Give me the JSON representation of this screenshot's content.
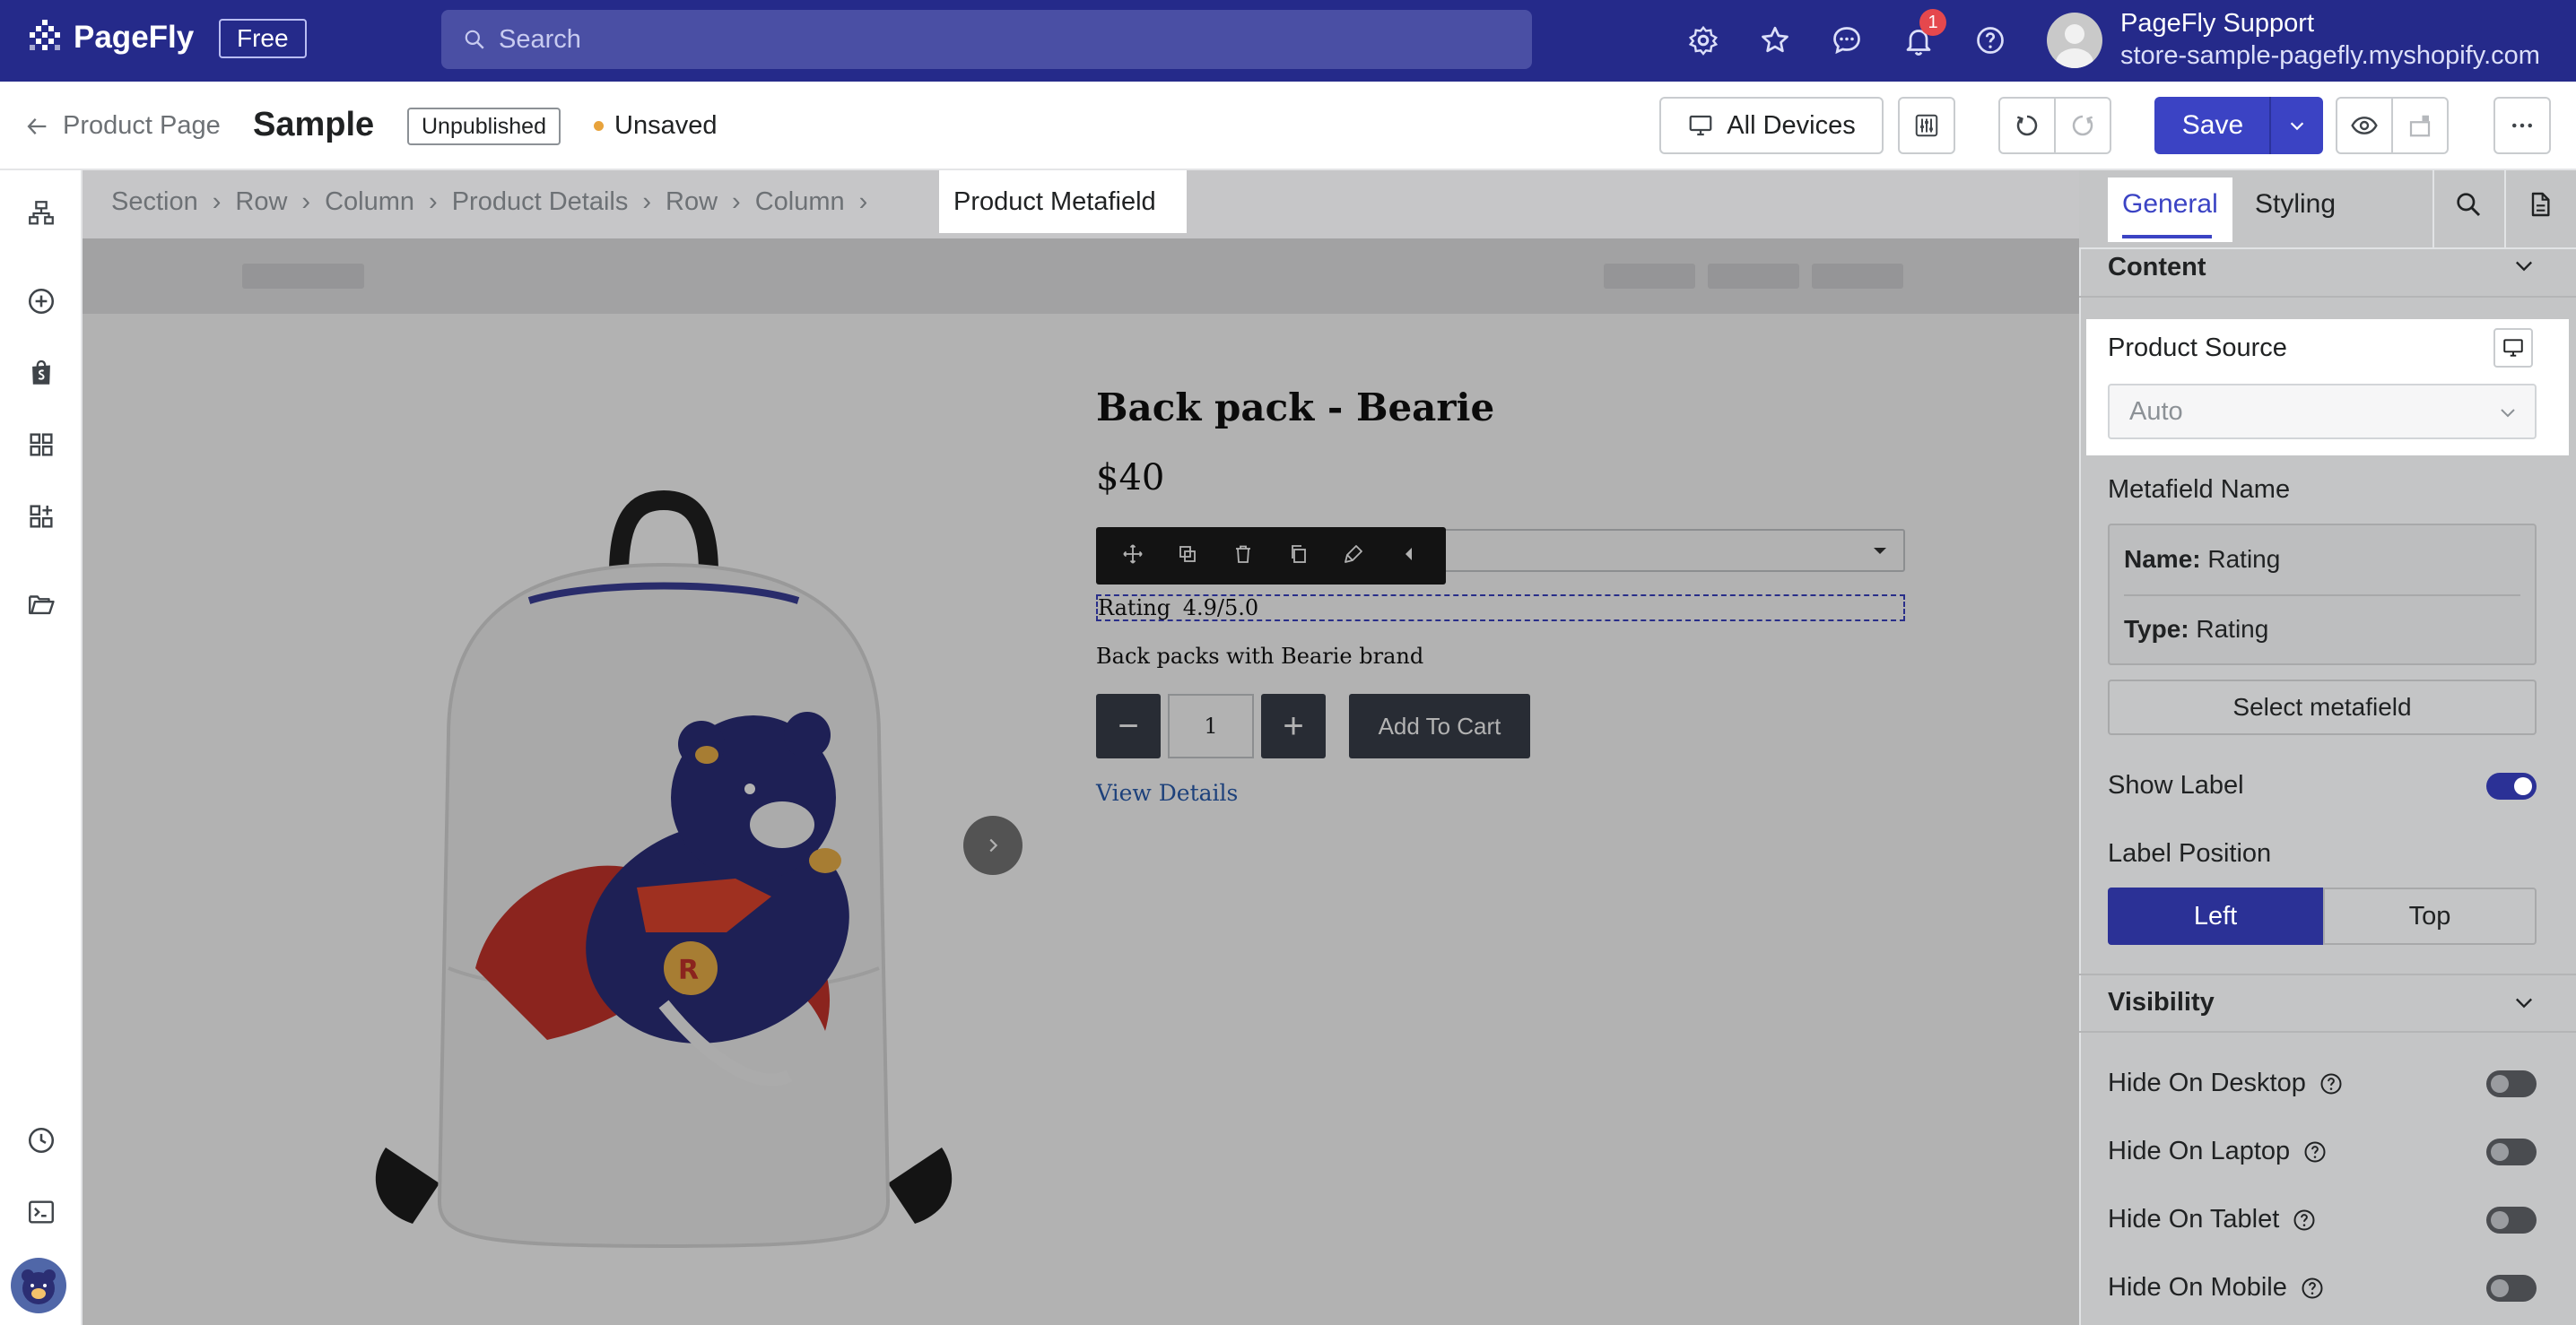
{
  "app": {
    "brand": "PageFly",
    "plan_badge": "Free"
  },
  "search": {
    "placeholder": "Search"
  },
  "notifications": {
    "count": "1"
  },
  "user": {
    "name": "PageFly Support",
    "store": "store-sample-pagefly.myshopify.com"
  },
  "toolbar": {
    "back_label": "Product Page",
    "page_name": "Sample",
    "publish_status": "Unpublished",
    "save_status": "Unsaved",
    "device_label": "All Devices",
    "save_label": "Save"
  },
  "breadcrumb": {
    "items": [
      "Section",
      "Row",
      "Column",
      "Product Details",
      "Row",
      "Column"
    ],
    "active": "Product Metafield"
  },
  "product": {
    "title": "Back pack - Bearie",
    "price": "$40",
    "rating_label": "Rating",
    "rating_value": "4.9/5.0",
    "description": "Back packs with Bearie brand",
    "quantity": "1",
    "add_to_cart": "Add To Cart",
    "view_details": "View Details"
  },
  "panel": {
    "tabs": [
      "General",
      "Styling"
    ],
    "content_heading": "Content",
    "product_source_label": "Product Source",
    "product_source_value": "Auto",
    "metafield_name_label": "Metafield Name",
    "metafield_name_key": "Name:",
    "metafield_name_value": "Rating",
    "metafield_type_key": "Type:",
    "metafield_type_value": "Rating",
    "select_metafield": "Select metafield",
    "show_label": "Show Label",
    "show_label_on": true,
    "label_position": "Label Position",
    "label_position_options": [
      "Left",
      "Top"
    ],
    "label_position_selected": "Left",
    "visibility_heading": "Visibility",
    "hide_on_desktop": "Hide On Desktop",
    "hide_on_laptop": "Hide On Laptop",
    "hide_on_tablet": "Hide On Tablet",
    "hide_on_mobile": "Hide On Mobile"
  },
  "colors": {
    "brand_bar": "#252a8a",
    "accent": "#3b43c4",
    "warning_dot": "#e8a33c"
  }
}
